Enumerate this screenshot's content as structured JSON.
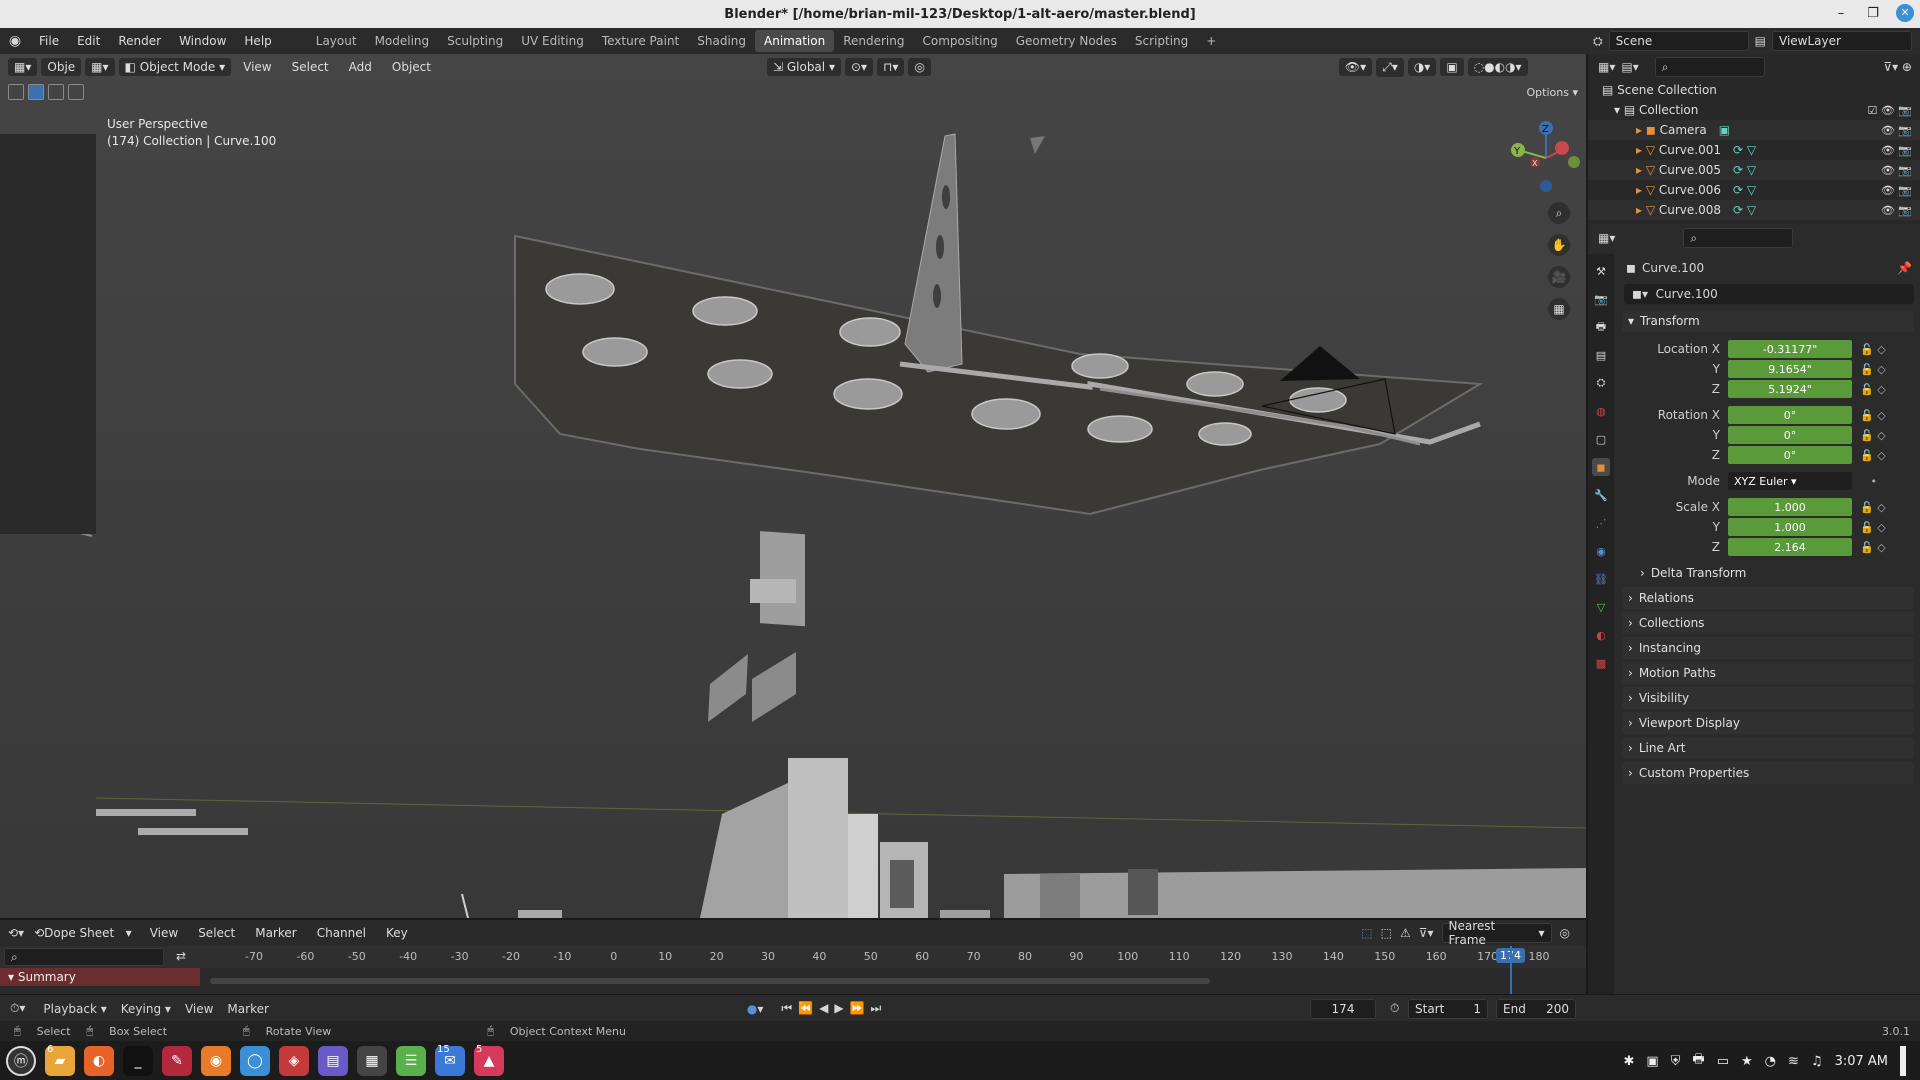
{
  "window": {
    "title": "Blender* [/home/brian-mil-123/Desktop/1-alt-aero/master.blend]"
  },
  "menubar": {
    "menus": [
      "File",
      "Edit",
      "Render",
      "Window",
      "Help"
    ],
    "workspaces": [
      "Layout",
      "Modeling",
      "Sculpting",
      "UV Editing",
      "Texture Paint",
      "Shading",
      "Animation",
      "Rendering",
      "Compositing",
      "Geometry Nodes",
      "Scripting"
    ],
    "active_workspace": "Animation",
    "scene": "Scene",
    "view_layer": "ViewLayer"
  },
  "viewport": {
    "header": {
      "mode": "Object Mode",
      "menus": [
        "View",
        "Select",
        "Add",
        "Object"
      ],
      "transform": "Global",
      "options": "Options"
    },
    "truncated_label": "Obje",
    "info_line1": "User Perspective",
    "info_line2": "(174) Collection | Curve.100",
    "gizmo_axes": [
      "Z",
      "Y",
      "X"
    ]
  },
  "outliner": {
    "root": "Scene Collection",
    "collection": "Collection",
    "items": [
      "Camera",
      "Curve.001",
      "Curve.005",
      "Curve.006",
      "Curve.008"
    ]
  },
  "properties": {
    "object_name": "Curve.100",
    "object_field": "Curve.100",
    "transform_label": "Transform",
    "location_label": "Location X",
    "location": {
      "x": "-0.31177\"",
      "y": "9.1654\"",
      "z": "5.1924\""
    },
    "rotation_label": "Rotation X",
    "rotation": {
      "x": "0°",
      "y": "0°",
      "z": "0°"
    },
    "mode_label": "Mode",
    "mode": "XYZ Euler",
    "scale_label": "Scale X",
    "scale": {
      "x": "1.000",
      "y": "1.000",
      "z": "2.164"
    },
    "axis_y": "Y",
    "axis_z": "Z",
    "panels": [
      "Delta Transform",
      "Relations",
      "Collections",
      "Instancing",
      "Motion Paths",
      "Visibility",
      "Viewport Display",
      "Line Art",
      "Custom Properties"
    ]
  },
  "dopesheet": {
    "editor": "Dope Sheet",
    "menus": [
      "View",
      "Select",
      "Marker",
      "Channel",
      "Key"
    ],
    "snap": "Nearest Frame",
    "ticks": [
      "-70",
      "-60",
      "-50",
      "-40",
      "-30",
      "-20",
      "-10",
      "0",
      "10",
      "20",
      "30",
      "40",
      "50",
      "60",
      "70",
      "80",
      "90",
      "100",
      "110",
      "120",
      "130",
      "140",
      "150",
      "160",
      "170",
      "180"
    ],
    "current_frame_badge": "174",
    "summary": "Summary"
  },
  "timeline": {
    "menus": [
      "Playback",
      "Keying",
      "View",
      "Marker"
    ],
    "current_frame": "174",
    "start_label": "Start",
    "start": "1",
    "end_label": "End",
    "end": "200"
  },
  "statusbar": {
    "select": "Select",
    "box_select": "Box Select",
    "rotate": "Rotate View",
    "context": "Object Context Menu",
    "version": "3.0.1"
  },
  "taskbar": {
    "badges": [
      "6",
      "15",
      "5"
    ],
    "clock": "3:07 AM"
  }
}
